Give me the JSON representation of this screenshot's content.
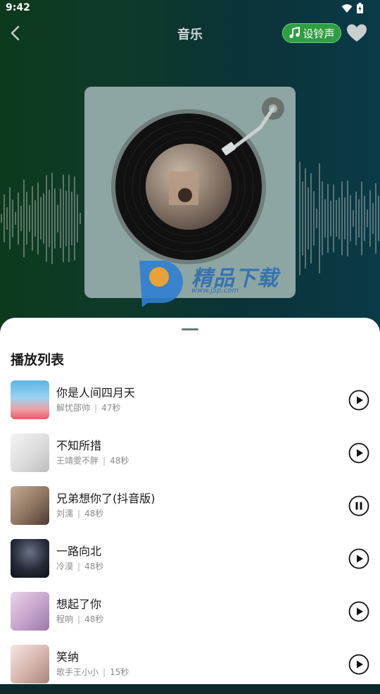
{
  "status_bar": {
    "time": "9:42"
  },
  "header": {
    "title": "音乐",
    "ringtone_button": "设铃声"
  },
  "watermark": {
    "brand": "精品下载",
    "url": "www.j5p.com"
  },
  "playlist": {
    "title": "播放列表",
    "items": [
      {
        "title": "你是人间四月天",
        "artist": "解忧邵帅",
        "duration": "47秒",
        "state": "play"
      },
      {
        "title": "不知所措",
        "artist": "王靖雯不胖",
        "duration": "48秒",
        "state": "play"
      },
      {
        "title": "兄弟想你了(抖音版)",
        "artist": "刘濡",
        "duration": "48秒",
        "state": "pause"
      },
      {
        "title": "一路向北",
        "artist": "冷漠",
        "duration": "48秒",
        "state": "play"
      },
      {
        "title": "想起了你",
        "artist": "程响",
        "duration": "48秒",
        "state": "play"
      },
      {
        "title": "笑纳",
        "artist": "歌手王小小",
        "duration": "15秒",
        "state": "play"
      }
    ]
  },
  "colors": {
    "accent_green": "#2f9e43",
    "sheet_bg": "#ffffff"
  },
  "icons": [
    "back-arrow-icon",
    "music-note-icon",
    "heart-icon",
    "wifi-icon",
    "battery-icon",
    "play-icon",
    "pause-icon"
  ]
}
